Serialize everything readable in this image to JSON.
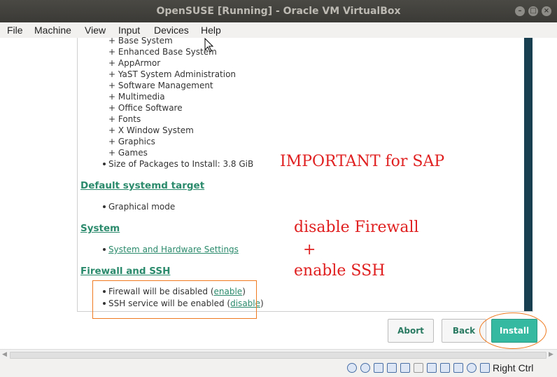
{
  "window": {
    "title": "OpenSUSE [Running] - Oracle VM VirtualBox"
  },
  "menu": {
    "items": [
      "File",
      "Machine",
      "View",
      "Input",
      "Devices",
      "Help"
    ]
  },
  "software": {
    "items": [
      "+ Base System",
      "+ Enhanced Base System",
      "+ AppArmor",
      "+ YaST System Administration",
      "+ Software Management",
      "+ Multimedia",
      "+ Office Software",
      "+ Fonts",
      "+ X Window System",
      "+ Graphics",
      "+ Games"
    ],
    "size": "Size of Packages to Install: 3.8 GiB"
  },
  "systemd": {
    "heading": "Default systemd target",
    "value": "Graphical mode"
  },
  "system": {
    "heading": "System",
    "link": "System and Hardware Settings"
  },
  "firewall": {
    "heading": "Firewall and SSH",
    "line1_pre": "Firewall will be disabled (",
    "line1_link": "enable",
    "line1_post": ")",
    "line2_pre": "SSH service will be enabled (",
    "line2_link": "disable",
    "line2_post": ")"
  },
  "annotations": {
    "important": "IMPORTANT  for  SAP",
    "disable": "disable  Firewall",
    "plus": "+",
    "enable": "enable  SSH"
  },
  "buttons": {
    "abort": "Abort",
    "back": "Back",
    "install": "Install"
  },
  "statusbar": {
    "hostkey": "Right Ctrl"
  },
  "colors": {
    "accent": "#2a8a6b",
    "primary_button": "#35b9a0",
    "annotation": "#e02020",
    "highlight": "#f07a20"
  }
}
